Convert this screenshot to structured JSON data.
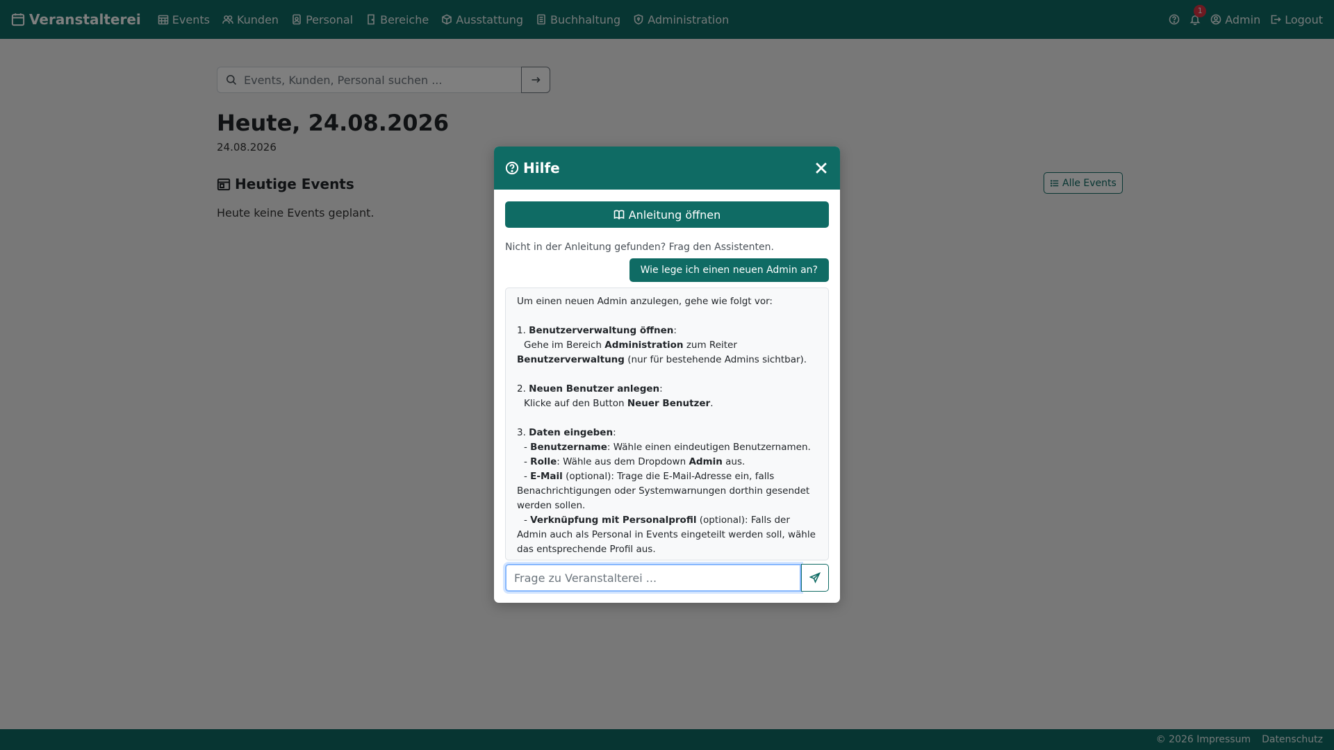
{
  "colors": {
    "primary": "#0f6b64",
    "badge": "#dc3545"
  },
  "navbar": {
    "brand": "Veranstalterei",
    "items": [
      {
        "label": "Events",
        "icon": "calendar-grid-icon"
      },
      {
        "label": "Kunden",
        "icon": "people-icon"
      },
      {
        "label": "Personal",
        "icon": "person-badge-icon"
      },
      {
        "label": "Bereiche",
        "icon": "door-icon"
      },
      {
        "label": "Ausstattung",
        "icon": "box-icon"
      },
      {
        "label": "Buchhaltung",
        "icon": "journal-icon"
      },
      {
        "label": "Administration",
        "icon": "shield-icon"
      }
    ],
    "notification_count": "1",
    "user_label": "Admin",
    "logout_label": "Logout"
  },
  "search": {
    "placeholder": "Events, Kunden, Personal suchen ..."
  },
  "page": {
    "title": "Heute, 24.08.2026",
    "date": "24.08.2026",
    "section_title": "Heutige Events",
    "all_events_label": "Alle Events",
    "empty_text": "Heute keine Events geplant."
  },
  "footer": {
    "copyright": "© 2026 Impressum",
    "privacy": "Datenschutz"
  },
  "modal": {
    "title": "Hilfe",
    "open_guide_label": "Anleitung öffnen",
    "hint": "Nicht in der Anleitung gefunden? Frag den Assistenten.",
    "user_question": "Wie lege ich einen neuen Admin an?",
    "answer": {
      "intro": "Um einen neuen Admin anzulegen, gehe wie folgt vor:",
      "s1_num": "1. ",
      "s1_title": "Benutzerverwaltung öffnen",
      "s1_l1": "Gehe im Bereich ",
      "s1_b1": "Administration",
      "s1_l2": " zum Reiter ",
      "s1_b2": "Benutzerverwaltung",
      "s1_l3": " (nur für bestehende Admins sichtbar).",
      "s2_num": "2. ",
      "s2_title": "Neuen Benutzer anlegen",
      "s2_l1": "Klicke auf den Button ",
      "s2_b1": "Neuer Benutzer",
      "s2_l2": ".",
      "s3_num": "3. ",
      "s3_title": "Daten eingeben",
      "b1_label": "Benutzername",
      "b1_text": ": Wähle einen eindeutigen Benutzernamen.",
      "b2_label": "Rolle",
      "b2_text": ": Wähle aus dem Dropdown ",
      "b2_bold": "Admin",
      "b2_end": " aus.",
      "b3_label": "E-Mail",
      "b3_text": " (optional): Trage die E-Mail-Adresse ein, falls Benachrichtigungen oder Systemwarnungen dorthin gesendet werden sollen.",
      "b4_label": "Verknüpfung mit Personalprofil",
      "b4_text": " (optional): Falls der Admin auch als Personal in Events eingeteilt werden soll, wähle das entsprechende Profil aus."
    },
    "ask_placeholder": "Frage zu Veranstalterei ..."
  }
}
